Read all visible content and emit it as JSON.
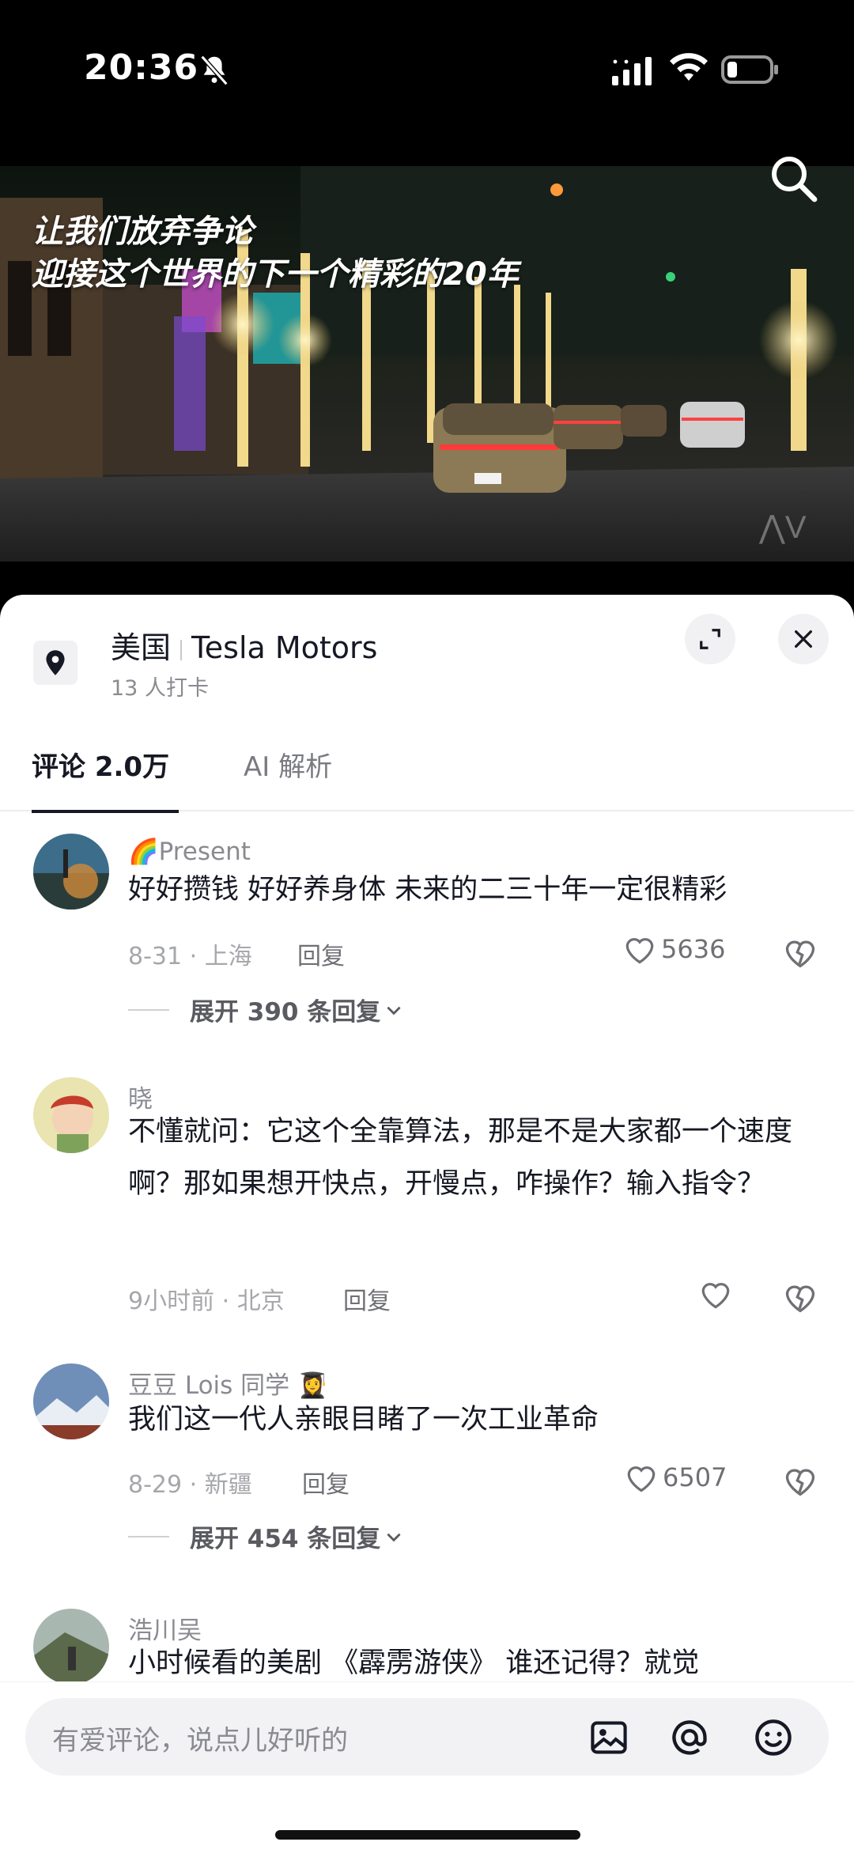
{
  "status_bar": {
    "time": "20:36",
    "icons": [
      "bell-muted-icon",
      "signal-icon",
      "wifi-icon",
      "battery-icon"
    ]
  },
  "video": {
    "caption_line1": "让我们放弃争论",
    "caption_line2": "迎接这个世界的下一个精彩的20年"
  },
  "location": {
    "country": "美国",
    "name": "Tesla Motors",
    "checkins": "13 人打卡"
  },
  "tabs": [
    {
      "label": "评论 2.0万",
      "active": true
    },
    {
      "label": "AI 解析",
      "active": false
    }
  ],
  "comments": [
    {
      "name": "🌈Present",
      "text": "好好攒钱 好好养身体  未来的二三十年一定很精彩",
      "date": "8-31 · 上海",
      "reply": "回复",
      "likes": "5636",
      "expand": "展开 390 条回复"
    },
    {
      "name": "晓",
      "text": "不懂就问：它这个全靠算法，那是不是大家都一个速度啊？那如果想开快点，开慢点，咋操作？输入指令？",
      "date": "9小时前 · 北京",
      "reply": "回复",
      "likes": ""
    },
    {
      "name": "豆豆 Lois 同学 👩‍🎓",
      "text": "我们这一代人亲眼目睹了一次工业革命",
      "date": "8-29 · 新疆",
      "reply": "回复",
      "likes": "6507",
      "expand": "展开 454 条回复"
    },
    {
      "name": "浩川吴",
      "text": "小时候看的美剧 《霹雳游侠》 谁还记得？就觉"
    }
  ],
  "input": {
    "placeholder": "有爱评论，说点儿好听的"
  },
  "colors": {
    "primary_text": "#161823",
    "secondary_text": "#8a8b91",
    "sheet_bg": "#ffffff"
  }
}
